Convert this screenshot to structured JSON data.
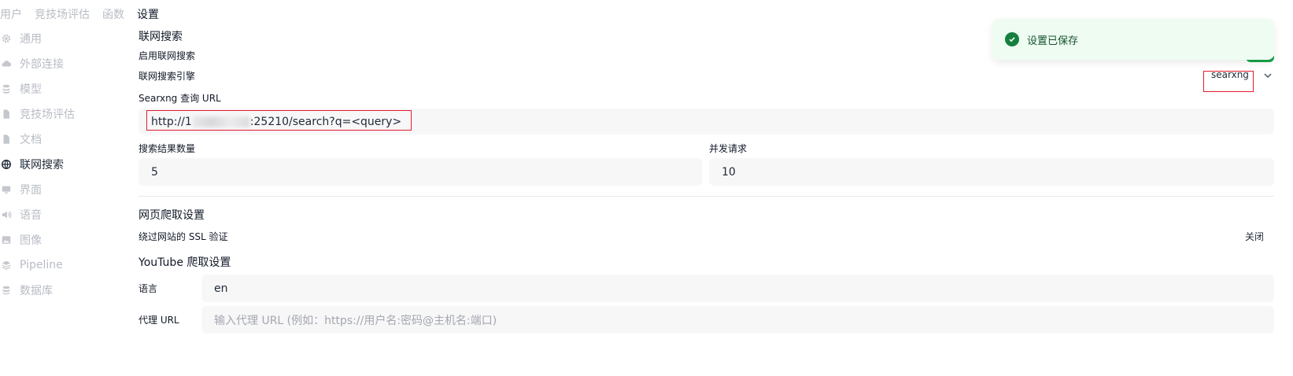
{
  "topnav": {
    "tabs": [
      {
        "label": "用户"
      },
      {
        "label": "竞技场评估"
      },
      {
        "label": "函数"
      },
      {
        "label": "设置"
      }
    ]
  },
  "sidebar": {
    "items": [
      {
        "label": "通用",
        "icon": "gear-icon"
      },
      {
        "label": "外部连接",
        "icon": "cloud-icon"
      },
      {
        "label": "模型",
        "icon": "cube-stack-icon"
      },
      {
        "label": "竞技场评估",
        "icon": "document-icon"
      },
      {
        "label": "文档",
        "icon": "document-icon"
      },
      {
        "label": "联网搜索",
        "icon": "globe-icon"
      },
      {
        "label": "界面",
        "icon": "monitor-icon"
      },
      {
        "label": "语音",
        "icon": "speaker-icon"
      },
      {
        "label": "图像",
        "icon": "image-icon"
      },
      {
        "label": "Pipeline",
        "icon": "layers-icon"
      },
      {
        "label": "数据库",
        "icon": "database-icon"
      }
    ]
  },
  "web_search": {
    "section_title": "联网搜索",
    "enable_label": "启用联网搜索",
    "engine_label": "联网搜索引擎",
    "engine_value": "searxng",
    "query_url_label": "Searxng 查询 URL",
    "query_url_prefix": "http://1",
    "query_url_suffix": ":25210/search?q=<query>",
    "result_count_label": "搜索结果数量",
    "result_count_value": "5",
    "concurrent_label": "并发请求",
    "concurrent_value": "10"
  },
  "crawl": {
    "section_title": "网页爬取设置",
    "ssl_label": "绕过网站的 SSL 验证",
    "ssl_value": "关闭"
  },
  "youtube": {
    "section_title": "YouTube 爬取设置",
    "language_label": "语言",
    "language_value": "en",
    "proxy_label": "代理 URL",
    "proxy_placeholder": "输入代理 URL (例如：https://用户名:密码@主机名:端口)"
  },
  "toast": {
    "message": "设置已保存"
  },
  "colors": {
    "accent_green": "#16a34a",
    "toast_bg": "#eefcf2",
    "highlight_red": "#e11d2e"
  }
}
